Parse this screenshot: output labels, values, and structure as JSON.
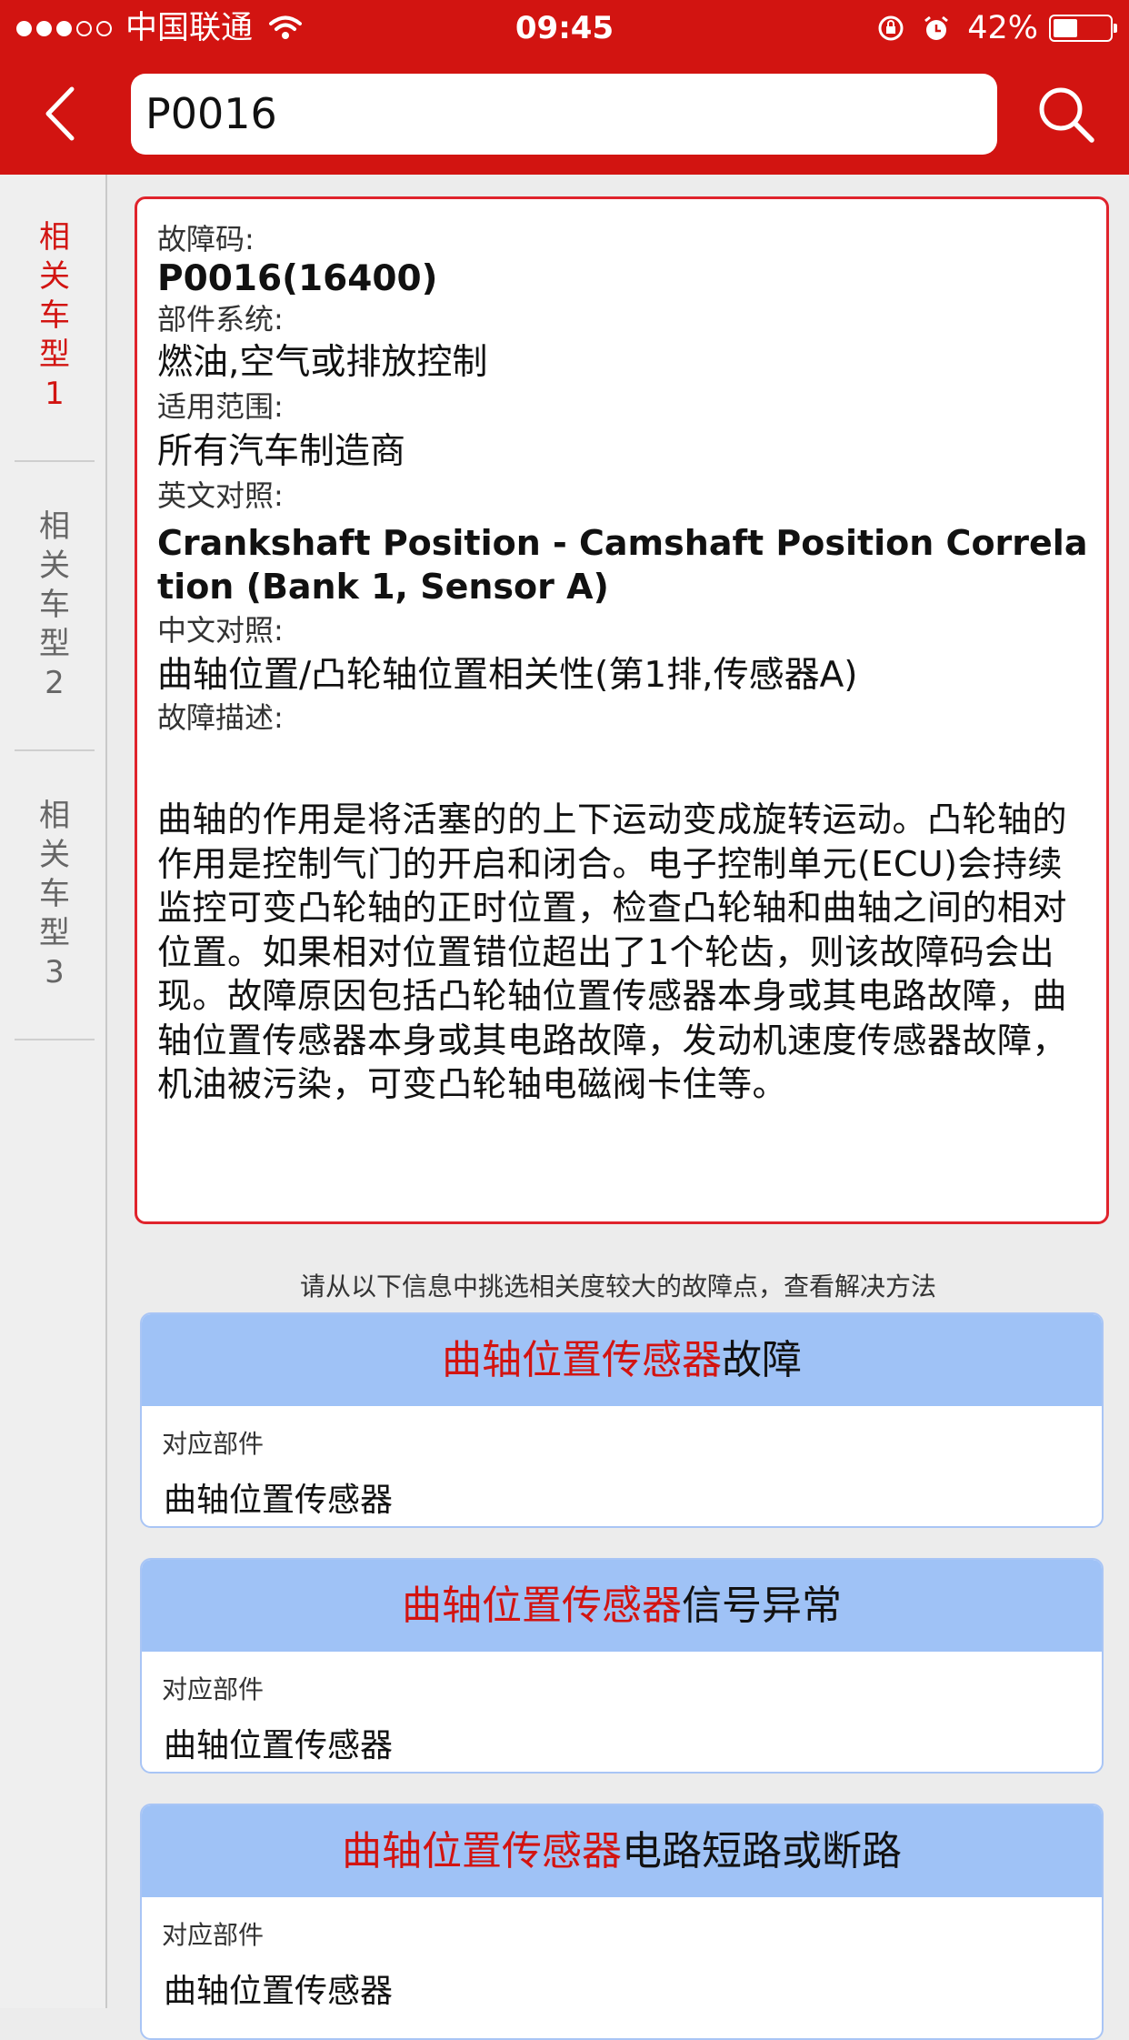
{
  "status_bar": {
    "carrier": "中国联通",
    "time": "09:45",
    "battery": "42%",
    "battery_level": 0.42,
    "signal_bars_filled": 3,
    "signal_bars_total": 5
  },
  "nav": {
    "search_value": "P0016",
    "back_icon": "chevron-left-icon",
    "search_icon": "search-icon"
  },
  "sidebar": {
    "items": [
      {
        "chars": [
          "相",
          "关",
          "车",
          "型"
        ],
        "num": "1",
        "active": true
      },
      {
        "chars": [
          "相",
          "关",
          "车",
          "型"
        ],
        "num": "2",
        "active": false
      },
      {
        "chars": [
          "相",
          "关",
          "车",
          "型"
        ],
        "num": "3",
        "active": false
      }
    ]
  },
  "info": {
    "code_label": "故障码:",
    "code_value": "P0016(16400)",
    "system_label": "部件系统:",
    "system_value": "燃油,空气或排放控制",
    "scope_label": "适用范围:",
    "scope_value": "所有汽车制造商",
    "english_label": "英文对照:",
    "english_value": "Crankshaft Position - Camshaft Position Correlation (Bank 1, Sensor A)",
    "chinese_label": "中文对照:",
    "chinese_value": "曲轴位置/凸轮轴位置相关性(第1排,传感器A)",
    "desc_label": "故障描述:",
    "desc_value": "曲轴的作用是将活塞的的上下运动变成旋转运动。凸轮轴的作用是控制气门的开启和闭合。电子控制单元(ECU)会持续监控可变凸轮轴的正时位置，检查凸轮轴和曲轴之间的相对位置。如果相对位置错位超出了1个轮齿，则该故障码会出现。故障原因包括凸轮轴位置传感器本身或其电路故障，曲轴位置传感器本身或其电路故障，发动机速度传感器故障，机油被污染，可变凸轮轴电磁阀卡住等。"
  },
  "hint": "请从以下信息中挑选相关度较大的故障点，查看解决方法",
  "faults": [
    {
      "title_red": "曲轴位置传感器",
      "title_black": "故障",
      "sub_label": "对应部件",
      "part": "曲轴位置传感器"
    },
    {
      "title_red": "曲轴位置传感器",
      "title_black": "信号异常",
      "sub_label": "对应部件",
      "part": "曲轴位置传感器"
    },
    {
      "title_red": "曲轴位置传感器",
      "title_black": "电路短路或断路",
      "sub_label": "对应部件",
      "part": "曲轴位置传感器"
    }
  ],
  "colors": {
    "brand_red": "#d21411",
    "card_header_blue": "#9fc2f6",
    "card_border_red": "#e0232c"
  }
}
